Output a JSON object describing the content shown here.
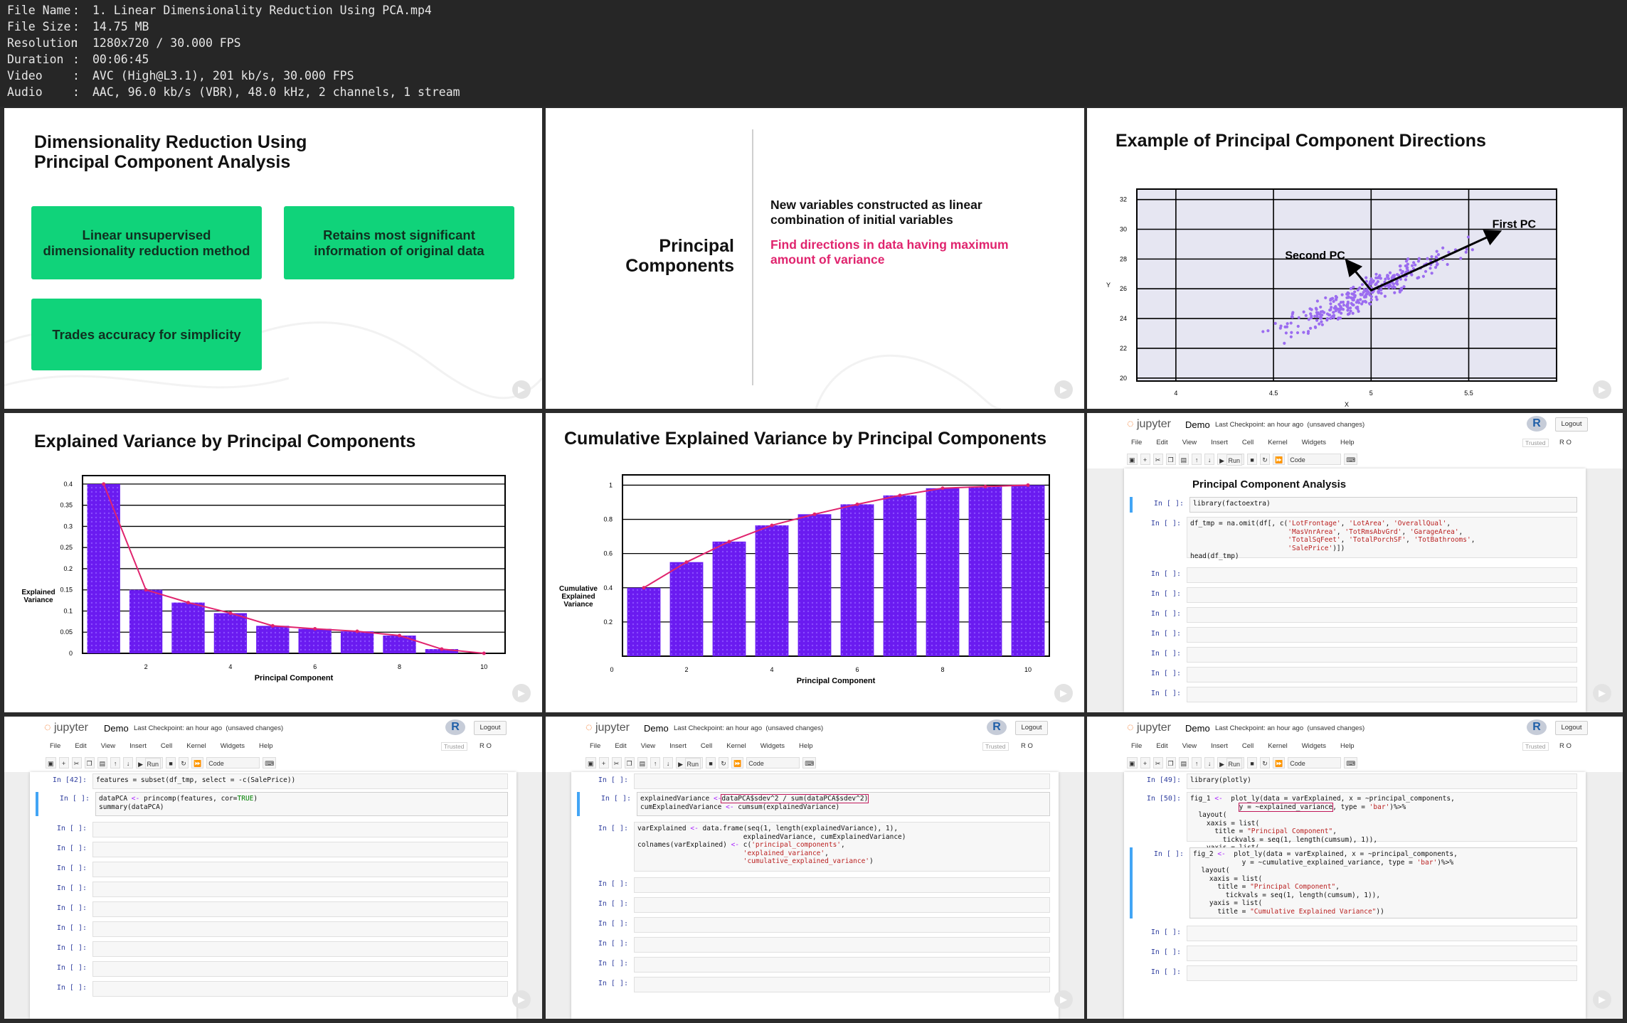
{
  "header": {
    "rows": [
      {
        "key": "File Name",
        "val": "1. Linear Dimensionality Reduction Using PCA.mp4"
      },
      {
        "key": "File Size",
        "val": "14.75 MB"
      },
      {
        "key": "Resolution",
        "val": "1280x720 / 30.000 FPS"
      },
      {
        "key": "Duration",
        "val": "00:06:45"
      },
      {
        "key": "Video",
        "val": "AVC (High@L3.1), 201 kb/s, 30.000 FPS"
      },
      {
        "key": "Audio",
        "val": "AAC, 96.0 kb/s (VBR), 48.0 kHz, 2 channels, 1 stream"
      }
    ]
  },
  "slide1": {
    "title1": "Dimensionality Reduction Using",
    "title2": "Principal Component Analysis",
    "box1a": "Linear unsupervised",
    "box1b": "dimensionality reduction method",
    "box2a": "Retains most significant",
    "box2b": "information of original data",
    "box3": "Trades accuracy for simplicity"
  },
  "slide2": {
    "title1": "Principal",
    "title2": "Components",
    "line1": "New variables constructed as linear",
    "line2": "combination of initial variables",
    "hl1": "Find directions in data having maximum",
    "hl2": "amount of variance"
  },
  "slide3": {
    "title": "Example of Principal Component Directions",
    "first_pc": "First PC",
    "second_pc": "Second PC",
    "xlabel": "X",
    "ylabel": "Y"
  },
  "slide4": {
    "title": "Explained Variance by Principal Components",
    "ylabel1": "Explained",
    "ylabel2": "Variance",
    "xlabel": "Principal Component"
  },
  "slide5": {
    "title": "Cumulative Explained Variance by Principal Components",
    "ylabel1": "Cumulative",
    "ylabel2": "Explained",
    "ylabel3": "Variance",
    "xlabel": "Principal Component"
  },
  "jupyter": {
    "logo": "jupyter",
    "notebook": "Demo",
    "checkpoint": "Last Checkpoint: an hour ago",
    "unsaved": "(unsaved changes)",
    "r": "R",
    "logout": "Logout",
    "trusted": "Trusted",
    "ro": "R O",
    "menu": [
      "File",
      "Edit",
      "View",
      "Insert",
      "Cell",
      "Kernel",
      "Widgets",
      "Help"
    ],
    "run": "Run",
    "celltype": "Code",
    "heading": "Principal Component Analysis"
  },
  "chart_data": [
    {
      "type": "scatter",
      "title": "Example of Principal Component Directions",
      "xlabel": "X",
      "ylabel": "Y",
      "xlim": [
        3.8,
        5.95
      ],
      "ylim": [
        19.8,
        32.7
      ],
      "xticks": [
        "4",
        "4.5",
        "5",
        "5.5"
      ],
      "yticks": [
        "20",
        "22",
        "24",
        "26",
        "28",
        "30",
        "32"
      ],
      "series": [
        {
          "name": "First PC",
          "x": [
            5.0,
            5.65
          ],
          "y": [
            25.9,
            29.8
          ]
        },
        {
          "name": "Second PC",
          "x": [
            5.0,
            4.88
          ],
          "y": [
            25.9,
            27.8
          ]
        }
      ]
    },
    {
      "type": "bar",
      "title": "Explained Variance by Principal Components",
      "xlabel": "Principal Component",
      "ylabel": "Explained Variance",
      "categories": [
        1,
        2,
        3,
        4,
        5,
        6,
        7,
        8,
        9,
        10
      ],
      "values": [
        0.4,
        0.15,
        0.12,
        0.095,
        0.065,
        0.058,
        0.052,
        0.042,
        0.01,
        0.0
      ],
      "ylim": [
        0,
        0.42
      ],
      "xticks": [
        "2",
        "4",
        "6",
        "8",
        "10"
      ],
      "yticks": [
        "0",
        "0.05",
        "0.1",
        "0.15",
        "0.2",
        "0.25",
        "0.3",
        "0.35",
        "0.4"
      ]
    },
    {
      "type": "bar",
      "title": "Cumulative Explained Variance by Principal Components",
      "xlabel": "Principal Component",
      "ylabel": "Cumulative Explained Variance",
      "categories": [
        1,
        2,
        3,
        4,
        5,
        6,
        7,
        8,
        9,
        10
      ],
      "values": [
        0.4,
        0.55,
        0.67,
        0.765,
        0.83,
        0.888,
        0.94,
        0.982,
        0.992,
        1.0
      ],
      "ylim": [
        0,
        1.06
      ],
      "xticks": [
        "0",
        "2",
        "4",
        "6",
        "8",
        "10"
      ],
      "yticks": [
        "0.2",
        "0.4",
        "0.6",
        "0.8",
        "1"
      ]
    }
  ]
}
